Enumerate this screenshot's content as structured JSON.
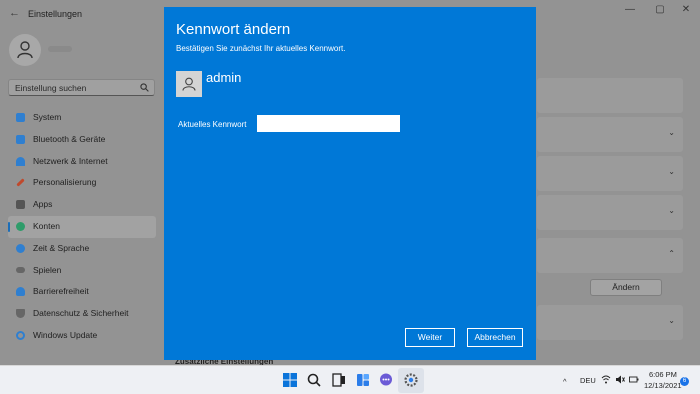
{
  "window": {
    "title": "Einstellungen"
  },
  "search": {
    "placeholder": "Einstellung suchen"
  },
  "sidebar": {
    "items": [
      {
        "label": "System",
        "icon": "monitor-icon",
        "color": "#2f7fd0"
      },
      {
        "label": "Bluetooth & Geräte",
        "icon": "bluetooth-icon",
        "color": "#2f7fd0"
      },
      {
        "label": "Netzwerk & Internet",
        "icon": "wifi-icon",
        "color": "#2f7fd0"
      },
      {
        "label": "Personalisierung",
        "icon": "brush-icon",
        "color": "#c0492c"
      },
      {
        "label": "Apps",
        "icon": "apps-icon",
        "color": "#555555"
      },
      {
        "label": "Konten",
        "icon": "person-icon",
        "color": "#2e9c6a",
        "active": true
      },
      {
        "label": "Zeit & Sprache",
        "icon": "globe-clock-icon",
        "color": "#2f7fd0"
      },
      {
        "label": "Spielen",
        "icon": "gamepad-icon",
        "color": "#666666"
      },
      {
        "label": "Barrierefreiheit",
        "icon": "accessibility-icon",
        "color": "#2f7fd0"
      },
      {
        "label": "Datenschutz & Sicherheit",
        "icon": "shield-icon",
        "color": "#666666"
      },
      {
        "label": "Windows Update",
        "icon": "update-icon",
        "color": "#2f7fd0"
      }
    ]
  },
  "content": {
    "change_button": "Ändern",
    "additional_settings": "Zusätzliche Einstellungen"
  },
  "dialog": {
    "title": "Kennwort ändern",
    "subtitle": "Bestätigen Sie zunächst Ihr aktuelles Kennwort.",
    "username": "admin",
    "password_label": "Aktuelles Kennwort",
    "password_value": "",
    "next_button": "Weiter",
    "cancel_button": "Abbrechen",
    "background": "#0078d7"
  },
  "taskbar": {
    "language": "DEU",
    "time": "6:06 PM",
    "date": "12/13/2021",
    "notification_count": "6"
  }
}
